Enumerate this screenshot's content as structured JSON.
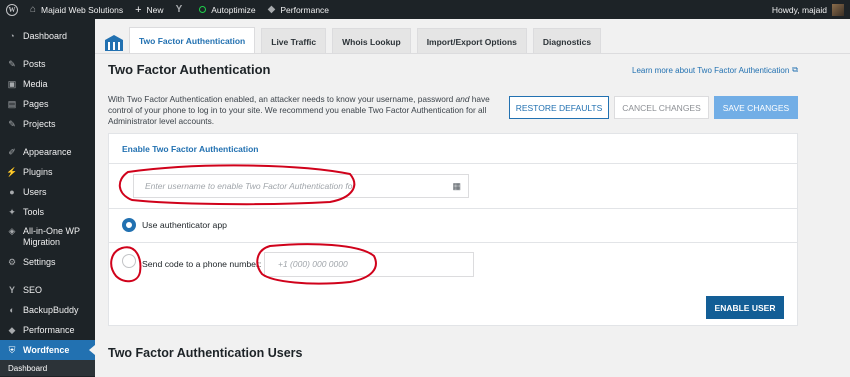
{
  "adminbar": {
    "site_name": "Majaid Web Solutions",
    "new_label": "New",
    "autoptimize_label": "Autoptimize",
    "performance_label": "Performance",
    "greeting": "Howdy, majaid"
  },
  "sidebar": {
    "items": [
      {
        "label": "Dashboard",
        "icon": "dashboard-icon"
      },
      {
        "label": "Posts",
        "icon": "pin-icon"
      },
      {
        "label": "Media",
        "icon": "media-icon"
      },
      {
        "label": "Pages",
        "icon": "pages-icon"
      },
      {
        "label": "Projects",
        "icon": "pin-icon"
      },
      {
        "label": "Appearance",
        "icon": "brush-icon"
      },
      {
        "label": "Plugins",
        "icon": "plugin-icon"
      },
      {
        "label": "Users",
        "icon": "user-icon"
      },
      {
        "label": "Tools",
        "icon": "wrench-icon"
      },
      {
        "label": "All-in-One WP Migration",
        "icon": "migration-icon"
      },
      {
        "label": "Settings",
        "icon": "settings-icon"
      },
      {
        "label": "SEO",
        "icon": "seo-icon"
      },
      {
        "label": "BackupBuddy",
        "icon": "backup-icon"
      },
      {
        "label": "Performance",
        "icon": "performance-icon"
      },
      {
        "label": "Wordfence",
        "icon": "shield-icon"
      }
    ],
    "submenu": [
      "Dashboard"
    ]
  },
  "tabs": [
    {
      "label": "Two Factor Authentication",
      "active": true
    },
    {
      "label": "Live Traffic",
      "active": false
    },
    {
      "label": "Whois Lookup",
      "active": false
    },
    {
      "label": "Import/Export Options",
      "active": false
    },
    {
      "label": "Diagnostics",
      "active": false
    }
  ],
  "main": {
    "title": "Two Factor Authentication",
    "learn_more": "Learn more about Two Factor Authentication",
    "description_1": "With Two Factor Authentication enabled, an attacker needs to know your username, password ",
    "description_em": "and",
    "description_2": " have control of your phone to log in to your site. We recommend you enable Two Factor Authentication for all Administrator level accounts.",
    "buttons": {
      "restore": "RESTORE DEFAULTS",
      "cancel": "CANCEL CHANGES",
      "save": "SAVE CHANGES"
    }
  },
  "card": {
    "heading": "Enable Two Factor Authentication",
    "username_placeholder": "Enter username to enable Two Factor Authentication for",
    "option_app": "Use authenticator app",
    "option_phone": "Send code to a phone number:",
    "phone_placeholder": "+1 (000) 000 0000",
    "enable_button": "ENABLE USER",
    "selected_option": "app"
  },
  "users_section_title": "Two Factor Authentication Users",
  "colors": {
    "accent": "#2271b1",
    "annotation": "#d0021b",
    "sidebar_bg": "#1d2327"
  }
}
